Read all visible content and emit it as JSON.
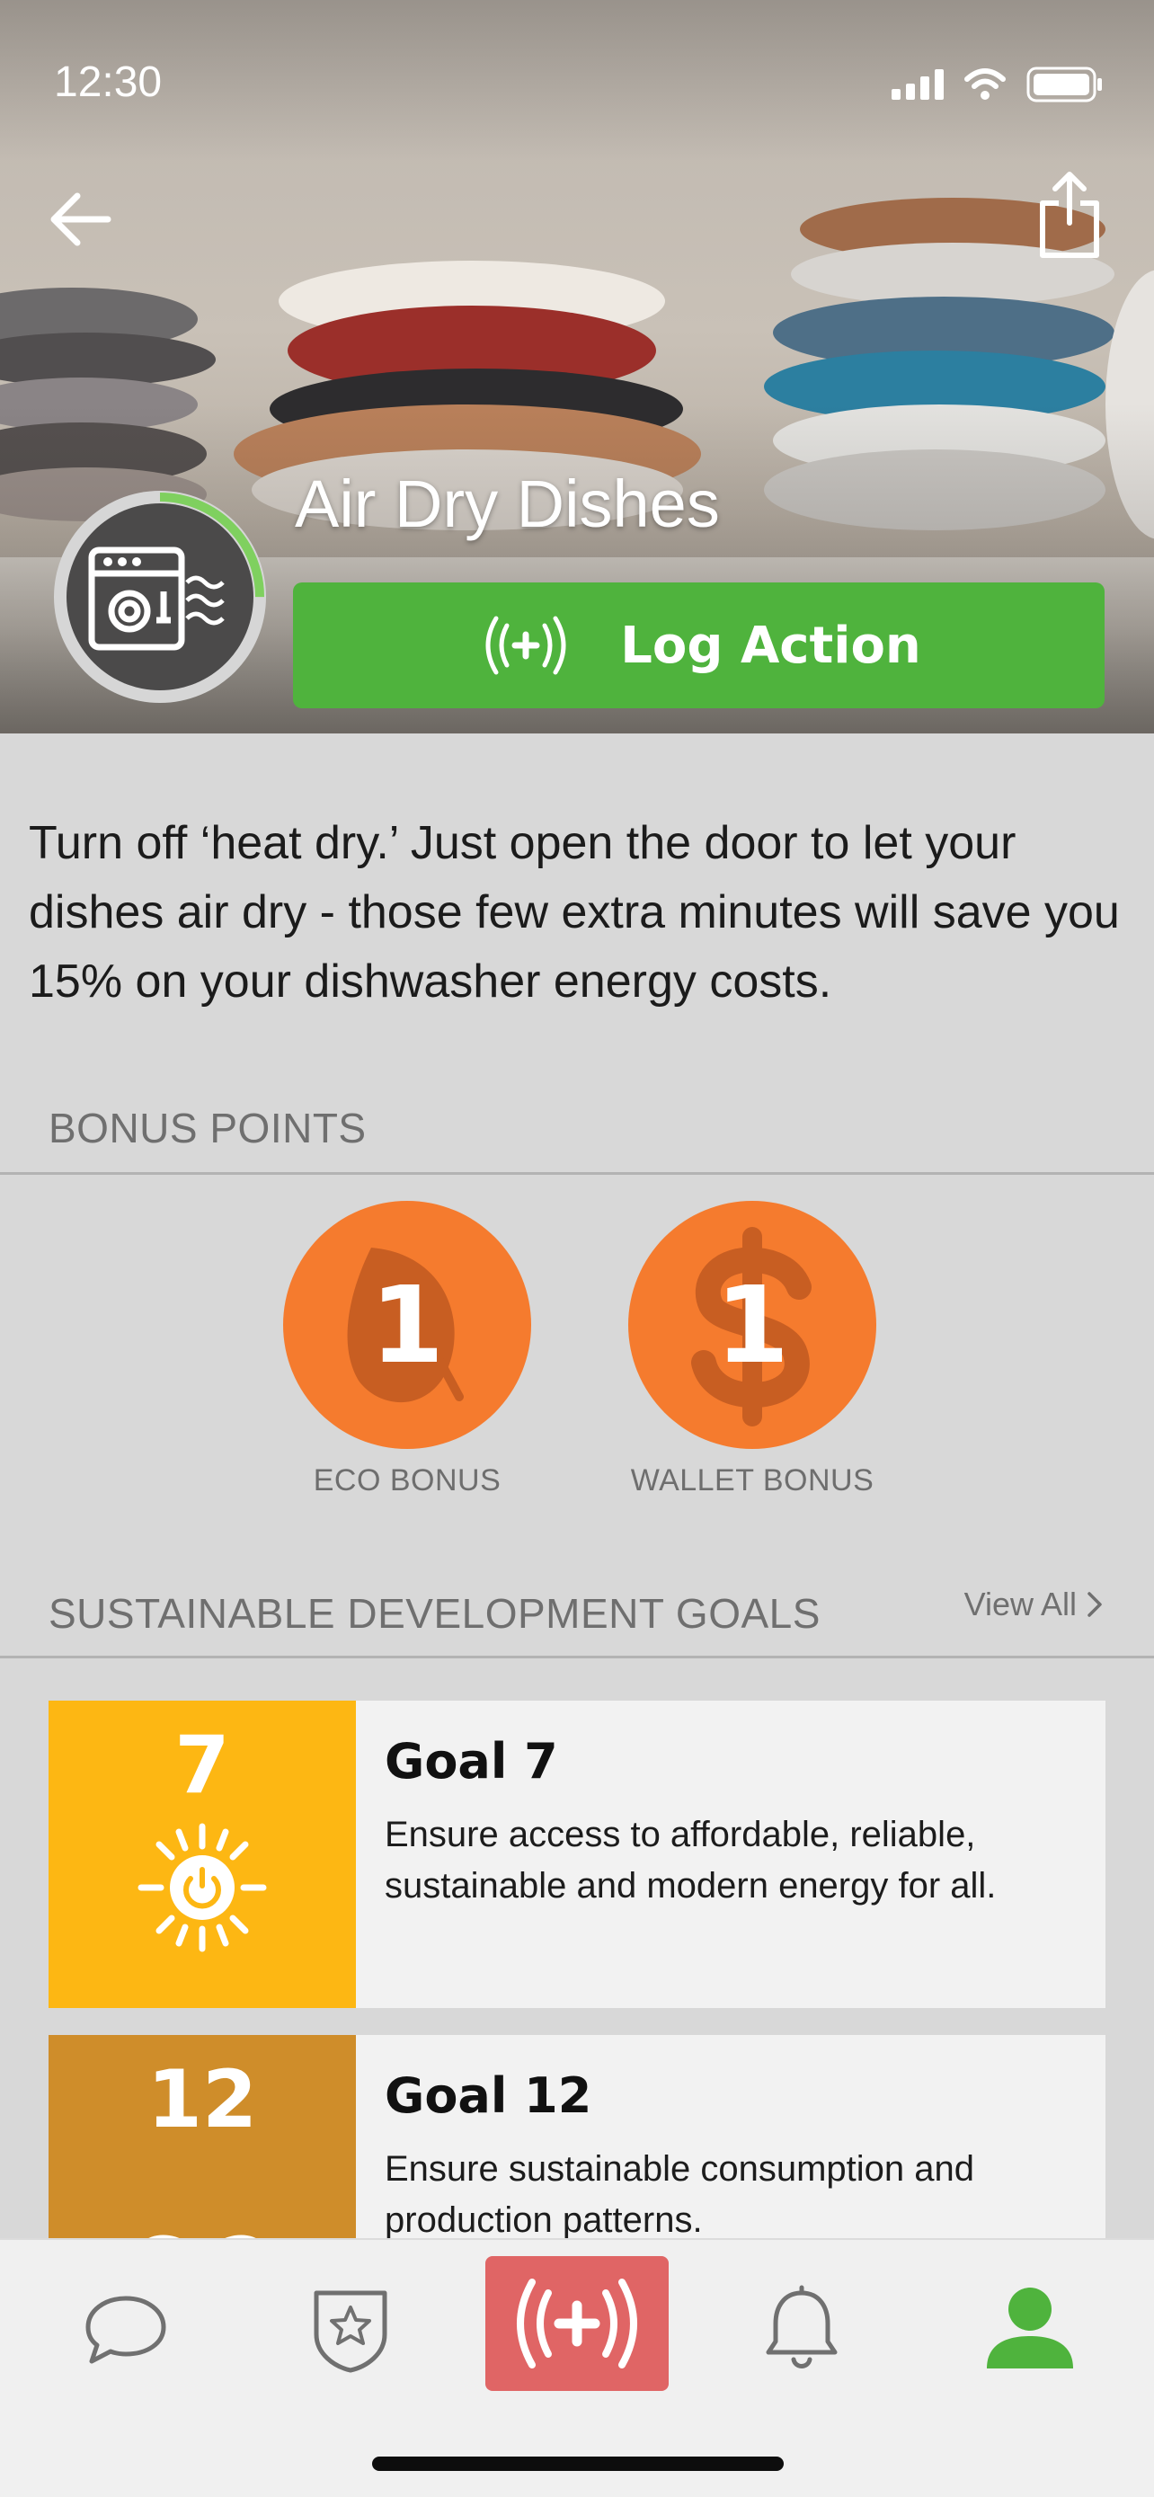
{
  "status_bar": {
    "time": "12:30"
  },
  "action": {
    "title": "Air Dry Dishes",
    "log_button_label": "Log Action",
    "progress": 0.25,
    "description": "Turn off ‘heat dry.’ Just open the door to let your dishes air dry - those few extra minutes will save you 15% on your dishwasher energy costs."
  },
  "bonus_points": {
    "section_title": "BONUS POINTS",
    "items": [
      {
        "value": "1",
        "label": "ECO BONUS",
        "icon": "leaf-icon"
      },
      {
        "value": "1",
        "label": "WALLET BONUS",
        "icon": "dollar-icon"
      }
    ]
  },
  "sdg": {
    "section_title": "SUSTAINABLE DEVELOPMENT GOALS",
    "view_all_label": "View All",
    "goals": [
      {
        "number": "7",
        "title": "Goal 7",
        "text": "Ensure access to affordable, reliable, sustainable and modern energy for all.",
        "color": "#fdb713",
        "icon": "sun-power-icon"
      },
      {
        "number": "12",
        "title": "Goal 12",
        "text": "Ensure sustainable consumption and production patterns.",
        "color": "#cf8d2a",
        "icon": "infinity-icon"
      }
    ]
  },
  "colors": {
    "log_button": "#4fb33d",
    "bonus": "#f57b2e",
    "tab_center": "#e06565",
    "tab_active": "#4fb33d",
    "progress_ring": "#7fd05f"
  },
  "tabbar": {
    "items": [
      "chat-icon",
      "badge-star-icon",
      "log-action-icon",
      "bell-icon",
      "profile-icon"
    ],
    "active": "profile-icon"
  }
}
